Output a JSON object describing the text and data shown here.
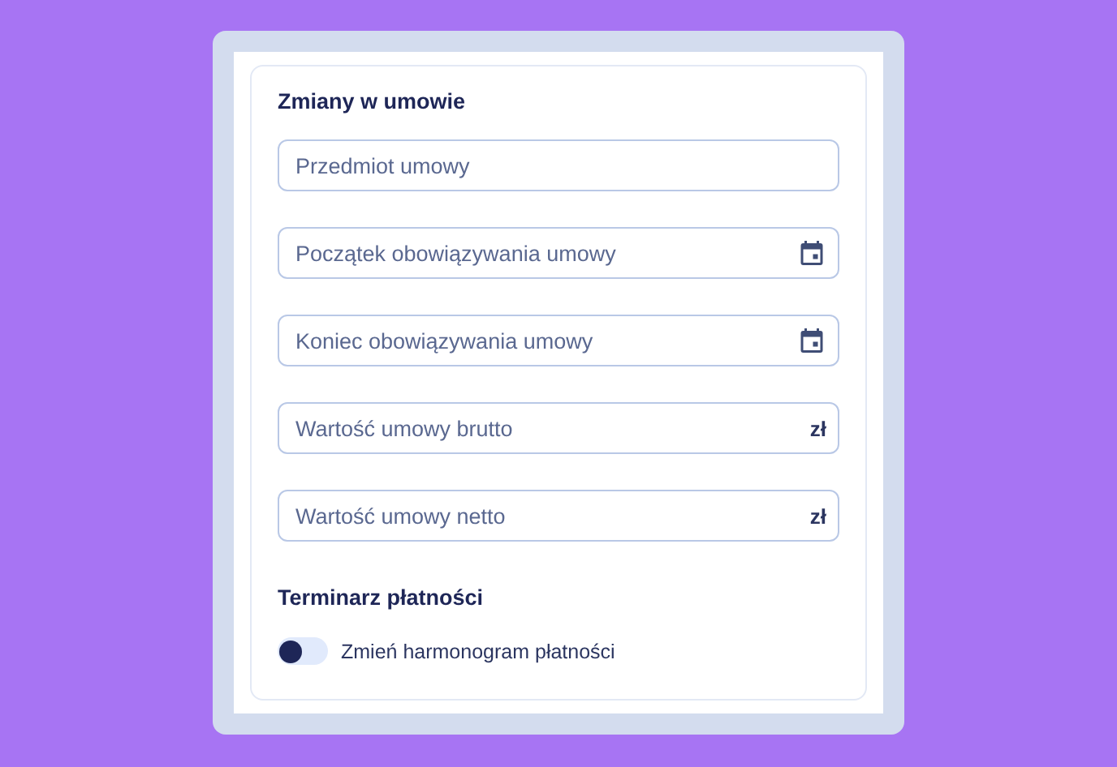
{
  "section_title": "Zmiany w umowie",
  "fields": [
    {
      "kind": "text",
      "placeholder": "Przedmiot umowy"
    },
    {
      "kind": "date",
      "placeholder": "Początek obowiązywania umowy"
    },
    {
      "kind": "date",
      "placeholder": "Koniec obowiązywania umowy"
    },
    {
      "kind": "currency",
      "placeholder": "Wartość umowy brutto",
      "suffix": "zł"
    },
    {
      "kind": "currency",
      "placeholder": "Wartość umowy netto",
      "suffix": "zł"
    }
  ],
  "payment_title": "Terminarz płatności",
  "toggle": {
    "label": "Zmień harmonogram płatności",
    "on": false
  }
}
